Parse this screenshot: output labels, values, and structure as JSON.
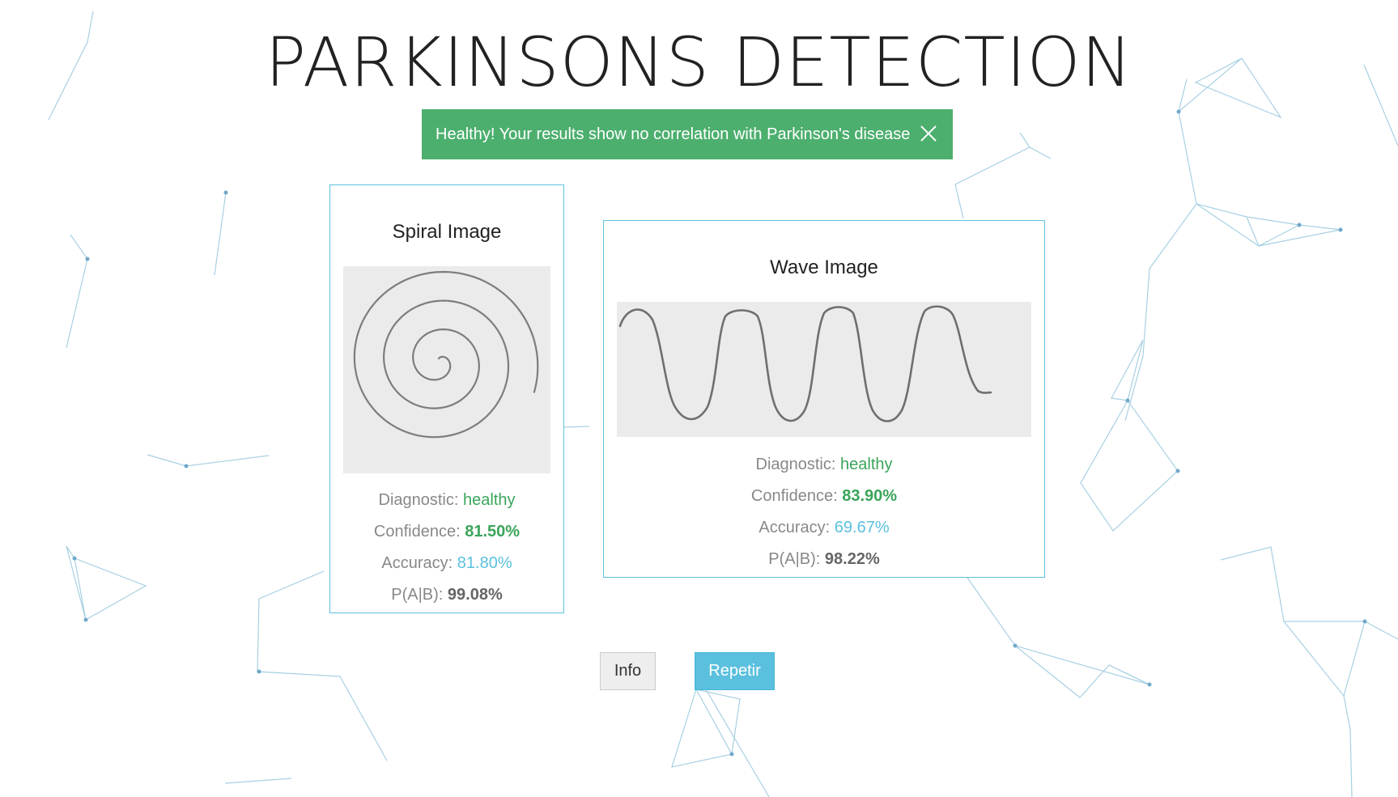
{
  "page": {
    "title": "PARKINSONS DETECTION"
  },
  "alert": {
    "message": "Healthy! Your results show no correlation with Parkinson's disease",
    "color": "#4caf6e"
  },
  "spiral": {
    "title": "Spiral Image",
    "diagnostic_label": "Diagnostic:",
    "diagnostic_value": "healthy",
    "confidence_label": "Confidence:",
    "confidence_value": "81.50%",
    "accuracy_label": "Accuracy:",
    "accuracy_value": "81.80%",
    "pab_label": "P(A|B):",
    "pab_value": "99.08%"
  },
  "wave": {
    "title": "Wave Image",
    "diagnostic_label": "Diagnostic:",
    "diagnostic_value": "healthy",
    "confidence_label": "Confidence:",
    "confidence_value": "83.90%",
    "accuracy_label": "Accuracy:",
    "accuracy_value": "69.67%",
    "pab_label": "P(A|B):",
    "pab_value": "98.22%"
  },
  "buttons": {
    "info_label": "Info",
    "repeat_label": "Repetir"
  },
  "colors": {
    "accent_blue": "#5bc0de",
    "success_green": "#3aa55a",
    "network_line": "#9ccbe0"
  },
  "icons": {
    "alert_close": "close-icon"
  }
}
